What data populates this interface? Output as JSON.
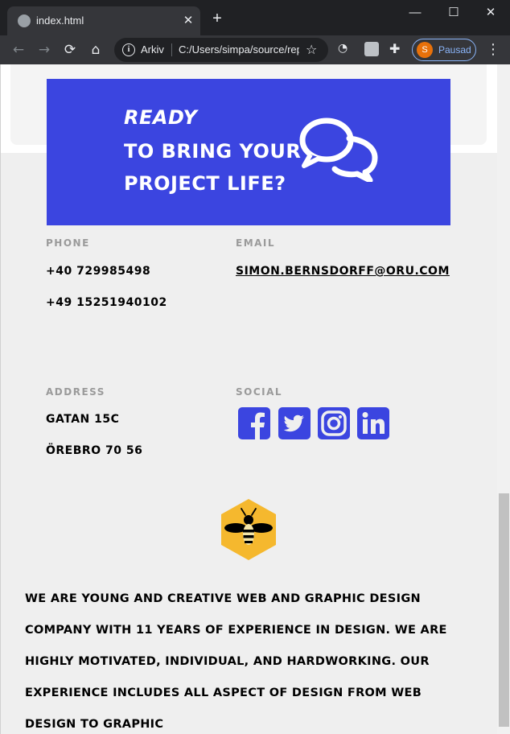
{
  "browser": {
    "tab_title": "index.html",
    "tab_close": "✕",
    "new_tab": "+",
    "window": {
      "minimize": "—",
      "maximize": "☐",
      "close": "✕"
    },
    "nav": {
      "back": "←",
      "forward": "→",
      "reload": "⟳",
      "home": "⌂"
    },
    "omnibox": {
      "info": "i",
      "scheme_label": "Arkiv",
      "url": "C:/Users/simpa/source/repos/index.html"
    },
    "star": "☆",
    "profile": {
      "initial": "S",
      "label": "Pausad"
    },
    "menu": "⋮",
    "puzzle": "✚",
    "ghost": "◔"
  },
  "banner": {
    "line1": "Ready",
    "line2": "to bring your",
    "line3": "project life?"
  },
  "contact": {
    "phone_label": "Phone",
    "phones": [
      "+40 729985498",
      "+49 15251940102"
    ],
    "email_label": "Email",
    "email": "simon.bernsdorff@oru.com",
    "address_label": "Address",
    "address": [
      "Gatan 15C",
      "Örebro 70 56"
    ],
    "social_label": "Social"
  },
  "social_icons": [
    "facebook-icon",
    "twitter-icon",
    "instagram-icon",
    "linkedin-icon"
  ],
  "about": "We are young and creative web and graphic design company with 11 years of experience in design. We are highly motivated, individual, and hardworking. Our experience includes all aspect of design from web design to graphic",
  "colors": {
    "accent": "#3b45e0",
    "bee_yellow": "#f5b82e",
    "page_bg": "#efefef"
  }
}
